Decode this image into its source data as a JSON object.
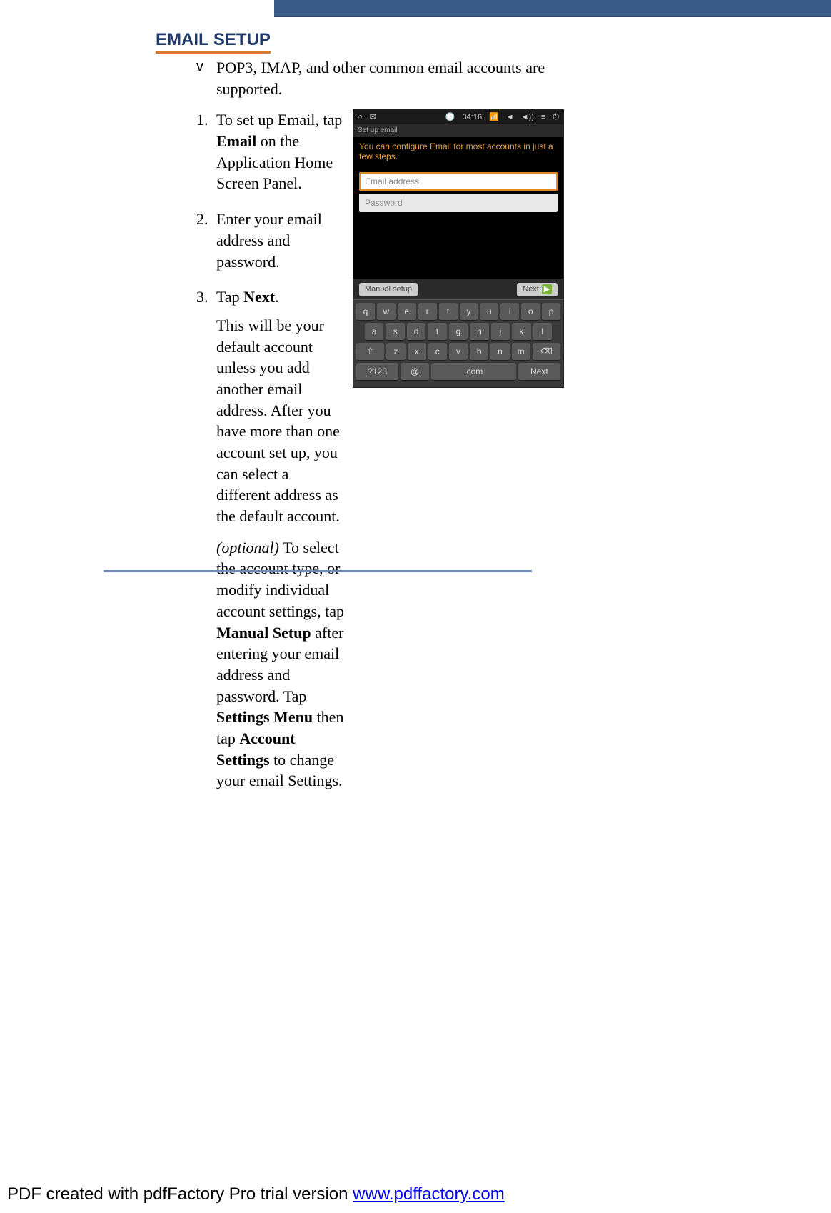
{
  "heading": "EMAIL SETUP",
  "bullet": {
    "mark": "v",
    "text": "POP3, IMAP, and other common email accounts are supported."
  },
  "steps": {
    "one": {
      "n": "1.",
      "a": "To set up Email, tap ",
      "b": "Email",
      "c": " on the Application Home Screen Panel."
    },
    "two": {
      "n": "2.",
      "text": "Enter your email address and password."
    },
    "three": {
      "n": "3.",
      "a": "Tap ",
      "b": "Next",
      "c": "."
    },
    "three_follow": "This will be your default account unless you add another email address. After you have more than one account set up, you can select a different address as the default account."
  },
  "optional": {
    "label": "(optional)",
    "a": " To select the account type, or modify individual account settings, tap ",
    "b": "Manual Setup",
    "c": " after entering your email address and password. Tap ",
    "d": "Settings Menu",
    "e": " then tap ",
    "f": "Account Settings",
    "g": " to change your email Settings."
  },
  "phone": {
    "time": "04:16",
    "subtitle": "Set up email",
    "instruction": "You can configure Email for most accounts in just a few steps.",
    "field_email": "Email address",
    "field_password": "Password",
    "manual": "Manual setup",
    "next": "Next",
    "keys_r1": [
      "q",
      "w",
      "e",
      "r",
      "t",
      "y",
      "u",
      "i",
      "o",
      "p"
    ],
    "keys_r2": [
      "a",
      "s",
      "d",
      "f",
      "g",
      "h",
      "j",
      "k",
      "l"
    ],
    "keys_r3": [
      "⇧",
      "z",
      "x",
      "c",
      "v",
      "b",
      "n",
      "m",
      "⌫"
    ],
    "keys_r4": [
      "?123",
      "@",
      ".com",
      "Next"
    ]
  },
  "footer": {
    "prefix": "PDF created with pdfFactory Pro trial version ",
    "link_text": "www.pdffactory.com"
  }
}
